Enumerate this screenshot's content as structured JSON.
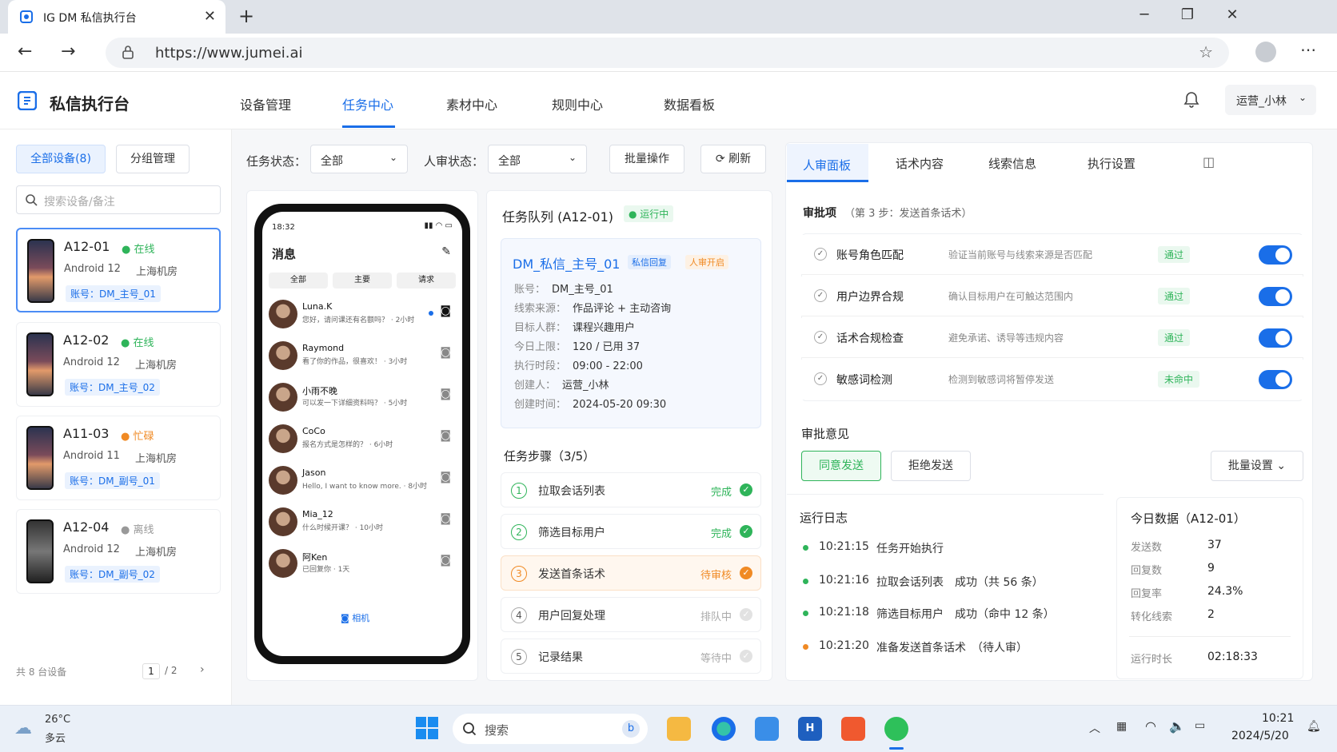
{
  "browser": {
    "tab_title": "IG DM 私信执行台",
    "url": "https://www.jumei.ai"
  },
  "app": {
    "title": "私信执行台",
    "nav": [
      "设备管理",
      "任务中心",
      "素材中心",
      "规则中心",
      "数据看板"
    ],
    "active_nav": "任务中心",
    "user": "运营_小林"
  },
  "devices_panel": {
    "tab_all": "全部设备(8)",
    "tab_group": "分组管理",
    "search_placeholder": "搜索设备/备注",
    "footer": "共 8 台设备",
    "page_current": "1",
    "page_total": "/ 2",
    "devices": [
      {
        "name": "A12-01",
        "status": "在线",
        "status_color": "#2fb45a",
        "os": "Android 12",
        "location": "上海机房",
        "account": "账号：DM_主号_01"
      },
      {
        "name": "A12-02",
        "status": "在线",
        "status_color": "#2fb45a",
        "os": "Android 12",
        "location": "上海机房",
        "account": "账号：DM_主号_02"
      },
      {
        "name": "A11-03",
        "status": "忙碌",
        "status_color": "#f08a24",
        "os": "Android 11",
        "location": "上海机房",
        "account": "账号：DM_副号_01"
      },
      {
        "name": "A12-04",
        "status": "离线",
        "status_color": "#999999",
        "os": "Android 12",
        "location": "上海机房",
        "account": "账号：DM_副号_02"
      }
    ]
  },
  "filters": {
    "task_status_label": "任务状态：",
    "task_status_value": "全部",
    "review_status_label": "人审状态：",
    "review_status_value": "全部",
    "batch": "批量操作",
    "refresh": "刷新"
  },
  "phone": {
    "time": "18:32",
    "title": "消息",
    "tabs": [
      "全部",
      "主要",
      "请求"
    ],
    "camera": "相机",
    "chats": [
      {
        "name": "Luna.K",
        "msg": "您好，请问课还有名额吗？ · 2小时",
        "unread": true
      },
      {
        "name": "Raymond",
        "msg": "看了你的作品，很喜欢！ · 3小时"
      },
      {
        "name": "小雨不晚",
        "msg": "可以发一下详细资料吗？ · 5小时"
      },
      {
        "name": "CoCo",
        "msg": "报名方式是怎样的？ · 6小时"
      },
      {
        "name": "Jason",
        "msg": "Hello, I want to know more. · 8小时"
      },
      {
        "name": "Mia_12",
        "msg": "什么时候开课？ · 10小时"
      },
      {
        "name": "阿Ken",
        "msg": "已回复你 · 1天"
      }
    ]
  },
  "task": {
    "queue_title": "任务队列 (A12-01)",
    "queue_status": "运行中",
    "name": "DM_私信_主号_01",
    "tag1": "私信回复",
    "tag2": "人审开启",
    "fields": [
      {
        "k": "账号：",
        "v": "DM_主号_01"
      },
      {
        "k": "线索来源：",
        "v": "作品评论 + 主动咨询"
      },
      {
        "k": "目标人群：",
        "v": "课程兴趣用户"
      },
      {
        "k": "今日上限：",
        "v": "120 / 已用 37"
      },
      {
        "k": "执行时段：",
        "v": "09:00 - 22:00"
      },
      {
        "k": "创建人：",
        "v": "运营_小林"
      },
      {
        "k": "创建时间：",
        "v": "2024-05-20 09:30"
      }
    ],
    "steps_title": "任务步骤（3/5）",
    "steps": [
      {
        "num": "1",
        "label": "拉取会话列表",
        "status": "完成",
        "color": "#2fb45a"
      },
      {
        "num": "2",
        "label": "筛选目标用户",
        "status": "完成",
        "color": "#2fb45a"
      },
      {
        "num": "3",
        "label": "发送首条话术",
        "status": "待审核",
        "color": "#f08a24"
      },
      {
        "num": "4",
        "label": "用户回复处理",
        "status": "排队中",
        "color": "#aaaaaa"
      },
      {
        "num": "5",
        "label": "记录结果",
        "status": "等待中",
        "color": "#aaaaaa"
      }
    ]
  },
  "review": {
    "tabs": [
      "人审面板",
      "话术内容",
      "线索信息",
      "执行设置"
    ],
    "approval_title": "审批项",
    "approval_sub": "（第 3 步：发送首条话术）",
    "items": [
      {
        "title": "账号角色匹配",
        "desc": "验证当前账号与线索来源是否匹配",
        "badge": "通过"
      },
      {
        "title": "用户边界合规",
        "desc": "确认目标用户在可触达范围内",
        "badge": "通过"
      },
      {
        "title": "话术合规检查",
        "desc": "避免承诺、诱导等违规内容",
        "badge": "通过"
      },
      {
        "title": "敏感词检测",
        "desc": "检测到敏感词将暂停发送",
        "badge": "未命中"
      }
    ],
    "opinion_title": "审批意见",
    "approve": "同意发送",
    "reject": "拒绝发送",
    "batch": "批量设置"
  },
  "log": {
    "title": "运行日志",
    "entries": [
      {
        "time": "10:21:15",
        "text": "任务开始执行",
        "color": "#2fb45a"
      },
      {
        "time": "10:21:16",
        "text": "拉取会话列表　成功（共 56 条）",
        "color": "#2fb45a"
      },
      {
        "time": "10:21:18",
        "text": "筛选目标用户　成功（命中 12 条）",
        "color": "#2fb45a"
      },
      {
        "time": "10:21:20",
        "text": "准备发送首条话术　（待人审）",
        "color": "#f08a24"
      }
    ]
  },
  "stats": {
    "title": "今日数据（A12-01）",
    "rows": [
      {
        "k": "发送数",
        "v": "37"
      },
      {
        "k": "回复数",
        "v": "9"
      },
      {
        "k": "回复率",
        "v": "24.3%"
      },
      {
        "k": "转化线索",
        "v": "2"
      }
    ],
    "runtime_label": "运行时长",
    "runtime": "02:18:33"
  },
  "taskbar": {
    "temp": "26°C",
    "weather": "多云",
    "search": "搜索",
    "time": "10:21",
    "date": "2024/5/20"
  }
}
